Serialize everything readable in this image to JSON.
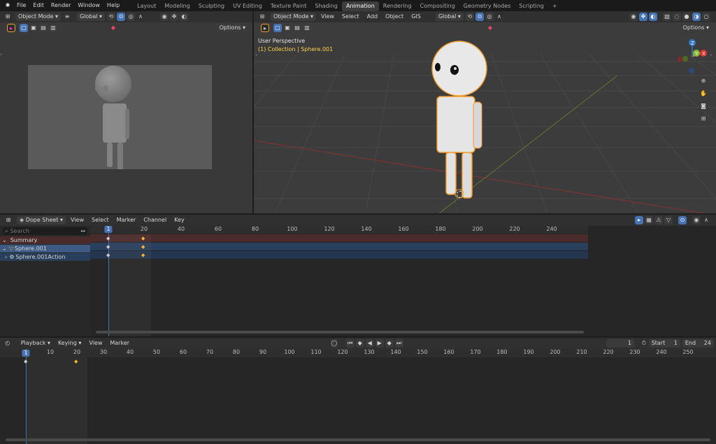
{
  "topbar": {
    "menus": [
      "File",
      "Edit",
      "Render",
      "Window",
      "Help"
    ],
    "workspaces": [
      "Layout",
      "Modeling",
      "Sculpting",
      "UV Editing",
      "Texture Paint",
      "Shading",
      "Animation",
      "Rendering",
      "Compositing",
      "Geometry Nodes",
      "Scripting"
    ],
    "active_workspace": "Animation",
    "add_tab": "+"
  },
  "camera_view": {
    "mode": "Object Mode",
    "orientation": "Global",
    "options": "Options"
  },
  "viewport": {
    "mode": "Object Mode",
    "menus": [
      "View",
      "Select",
      "Add",
      "Object",
      "GIS"
    ],
    "orientation": "Global",
    "options": "Options",
    "overlay_title": "User Perspective",
    "overlay_collection": "(1) Collection | Sphere.001",
    "gizmo_axes": {
      "x": "X",
      "y": "Y",
      "z": "Z"
    }
  },
  "dopesheet": {
    "editor": "Dope Sheet",
    "menus": [
      "View",
      "Select",
      "Marker",
      "Channel",
      "Key"
    ],
    "search_placeholder": "Search",
    "current_frame": "1",
    "ruler": [
      "20",
      "40",
      "60",
      "80",
      "100",
      "120",
      "140",
      "160",
      "180",
      "200",
      "220",
      "240"
    ],
    "channels": [
      {
        "label": "Summary"
      },
      {
        "label": "Sphere.001"
      },
      {
        "label": "Sphere.001Action"
      }
    ]
  },
  "timeline": {
    "menus": [
      "Playback",
      "Keying",
      "View",
      "Marker"
    ],
    "current_frame": "1",
    "frame_field": "1",
    "start_label": "Start",
    "start_value": "1",
    "end_label": "End",
    "end_value": "24",
    "ruler": [
      "10",
      "20",
      "30",
      "40",
      "50",
      "60",
      "70",
      "80",
      "90",
      "100",
      "110",
      "120",
      "130",
      "140",
      "150",
      "160",
      "170",
      "180",
      "190",
      "200",
      "210",
      "220",
      "230",
      "240",
      "250"
    ]
  },
  "colors": {
    "accent": "#4772b3",
    "selection": "#f39c2b",
    "keyframe": "#ffb52b",
    "summary_row": "#4a2b2b",
    "object_row": "#2a3f5c"
  }
}
